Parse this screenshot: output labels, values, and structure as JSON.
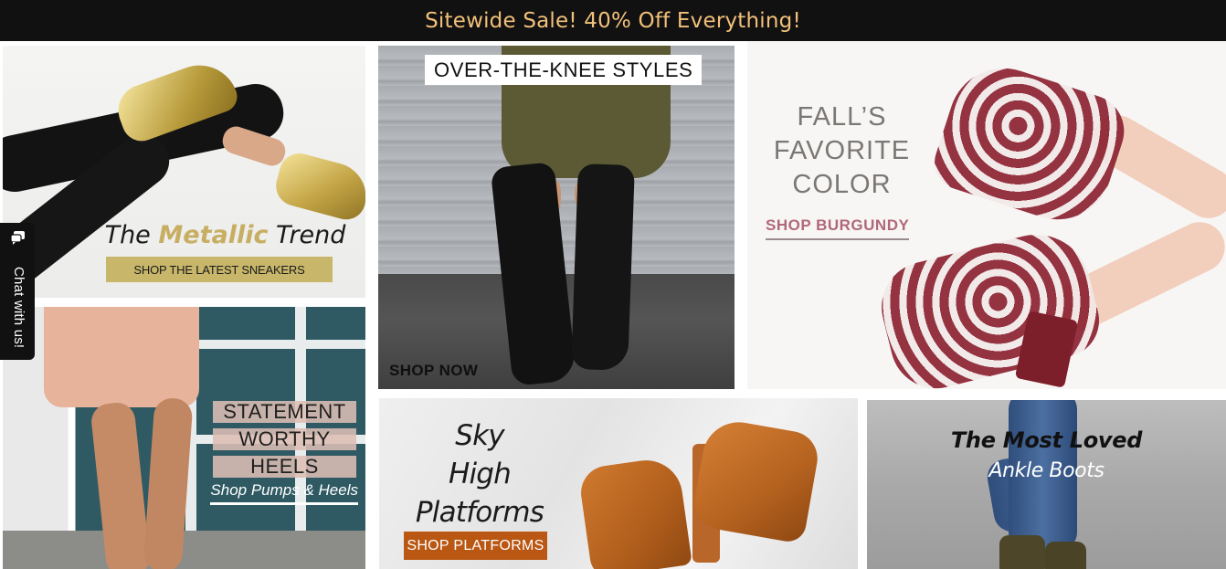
{
  "banner": {
    "text": "Sitewide Sale! 40% Off Everything!"
  },
  "tiles": {
    "metallic": {
      "heading_pre": "The ",
      "heading_accent": "Metallic",
      "heading_post": " Trend",
      "button": "SHOP THE LATEST SNEAKERS"
    },
    "over_the_knee": {
      "label": "OVER-THE-KNEE STYLES",
      "cta": "SHOP NOW"
    },
    "burgundy": {
      "heading_line1": "FALL’S",
      "heading_line2": "FAVORITE",
      "heading_line3": "COLOR",
      "cta": "SHOP BURGUNDY"
    },
    "statement": {
      "word1": "STATEMENT",
      "word2": "WORTHY",
      "word3": "HEELS",
      "cta": "Shop Pumps & Heels"
    },
    "platforms": {
      "heading_line1": "Sky",
      "heading_line2": "High",
      "heading_line3": "Platforms",
      "button": "SHOP PLATFORMS"
    },
    "ankle": {
      "heading_line1": "The Most Loved",
      "heading_line2": "Ankle Boots"
    }
  },
  "chat": {
    "label": "Chat with us!",
    "icon": "chat-bubble-icon"
  },
  "colors": {
    "banner_bg": "#111111",
    "banner_text": "#f2c07a",
    "metallic_accent": "#c7ae63",
    "burgundy_cta": "#b0687a",
    "platforms_button": "#b95713"
  }
}
